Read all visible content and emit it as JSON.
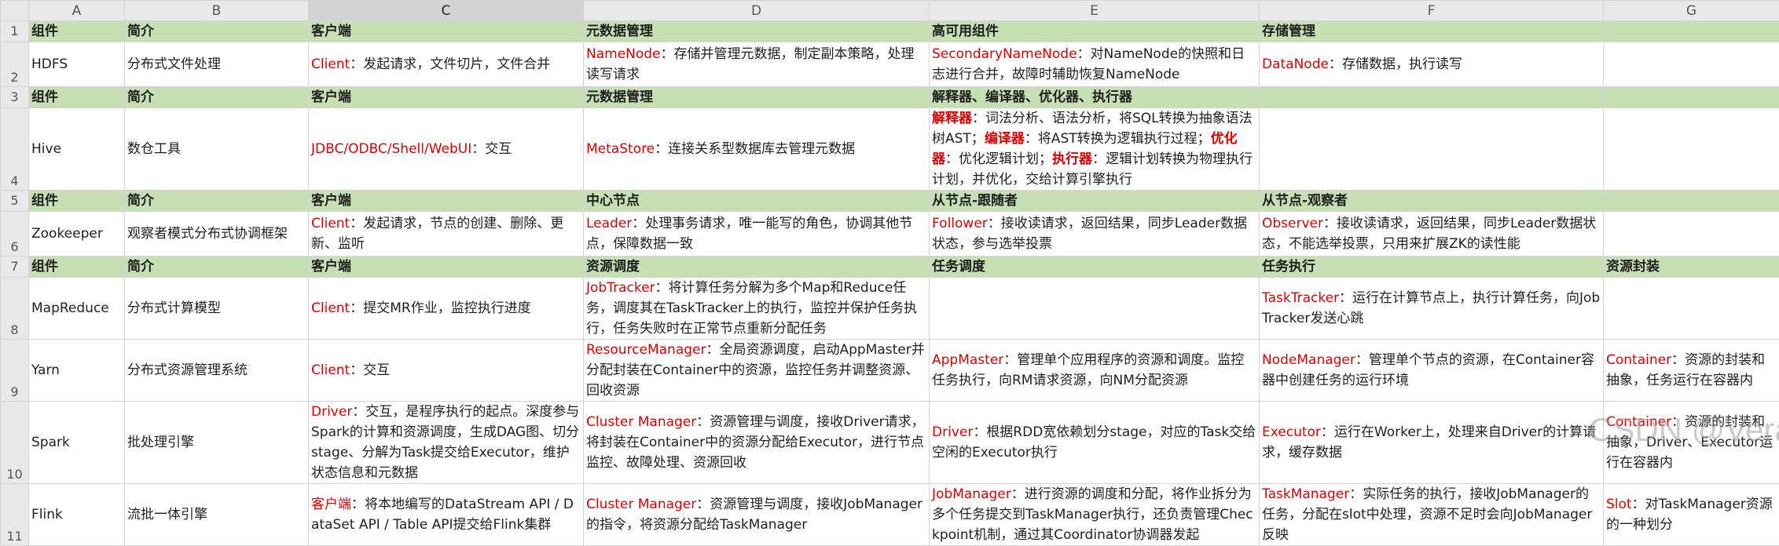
{
  "columns": [
    "A",
    "B",
    "C",
    "D",
    "E",
    "F",
    "G"
  ],
  "selected_column": "C",
  "rows": [
    {
      "num": "1",
      "header": true,
      "cells": [
        [
          {
            "t": "组件"
          }
        ],
        [
          {
            "t": "简介"
          }
        ],
        [
          {
            "t": "客户端"
          }
        ],
        [
          {
            "t": "元数据管理"
          }
        ],
        [
          {
            "t": "高可用组件"
          }
        ],
        [
          {
            "t": "存储管理"
          }
        ],
        []
      ]
    },
    {
      "num": "2",
      "header": false,
      "cells": [
        [
          {
            "t": "HDFS"
          }
        ],
        [
          {
            "t": "分布式文件处理"
          }
        ],
        [
          {
            "t": "Client",
            "k": 1
          },
          {
            "t": "：发起请求，文件切片，文件合并"
          }
        ],
        [
          {
            "t": "NameNode",
            "k": 1
          },
          {
            "t": "：存储并管理元数据，制定副本策略，处理读写请求"
          }
        ],
        [
          {
            "t": "SecondaryNameNode",
            "k": 1
          },
          {
            "t": "：对NameNode的快照和日志进行合并，故障时辅助恢复NameNode"
          }
        ],
        [
          {
            "t": "DataNode",
            "k": 1
          },
          {
            "t": "：存储数据，执行读写"
          }
        ],
        []
      ]
    },
    {
      "num": "3",
      "header": true,
      "cells": [
        [
          {
            "t": "组件"
          }
        ],
        [
          {
            "t": "简介"
          }
        ],
        [
          {
            "t": "客户端"
          }
        ],
        [
          {
            "t": "元数据管理"
          }
        ],
        [
          {
            "t": "解释器、编译器、优化器、执行器"
          }
        ],
        [],
        []
      ]
    },
    {
      "num": "4",
      "header": false,
      "cells": [
        [
          {
            "t": "Hive"
          }
        ],
        [
          {
            "t": "数仓工具"
          }
        ],
        [
          {
            "t": "JDBC/ODBC/Shell/WebUI",
            "k": 1
          },
          {
            "t": "：交互"
          }
        ],
        [
          {
            "t": "MetaStore",
            "k": 1
          },
          {
            "t": "：连接关系型数据库去管理元数据"
          }
        ],
        [
          {
            "t": "解释器",
            "k": 2
          },
          {
            "t": "：词法分析、语法分析，将SQL转换为抽象语法树AST；"
          },
          {
            "t": "编译器",
            "k": 2
          },
          {
            "t": "：将AST转换为逻辑执行过程；"
          },
          {
            "t": "优化器",
            "k": 2
          },
          {
            "t": "：优化逻辑计划；"
          },
          {
            "t": "执行器",
            "k": 2
          },
          {
            "t": "：逻辑计划转换为物理执行计划，并优化，交给计算引擎执行"
          }
        ],
        [],
        []
      ]
    },
    {
      "num": "5",
      "header": true,
      "cells": [
        [
          {
            "t": "组件"
          }
        ],
        [
          {
            "t": "简介"
          }
        ],
        [
          {
            "t": "客户端"
          }
        ],
        [
          {
            "t": "中心节点"
          }
        ],
        [
          {
            "t": "从节点-跟随者"
          }
        ],
        [
          {
            "t": "从节点-观察者"
          }
        ],
        []
      ]
    },
    {
      "num": "6",
      "header": false,
      "cells": [
        [
          {
            "t": "Zookeeper"
          }
        ],
        [
          {
            "t": "观察者模式分布式协调框架"
          }
        ],
        [
          {
            "t": "Client",
            "k": 1
          },
          {
            "t": "：发起请求，节点的创建、删除、更新、监听"
          }
        ],
        [
          {
            "t": "Leader",
            "k": 1
          },
          {
            "t": "：处理事务请求，唯一能写的角色，协调其他节点，保障数据一致"
          }
        ],
        [
          {
            "t": "Follower",
            "k": 1
          },
          {
            "t": "：接收读请求，返回结果，同步Leader数据状态，参与选举投票"
          }
        ],
        [
          {
            "t": "Observer",
            "k": 1
          },
          {
            "t": "：接收读请求，返回结果，同步Leader数据状态，不能选举投票，只用来扩展ZK的读性能"
          }
        ],
        []
      ]
    },
    {
      "num": "7",
      "header": true,
      "cells": [
        [
          {
            "t": "组件"
          }
        ],
        [
          {
            "t": "简介"
          }
        ],
        [
          {
            "t": "客户端"
          }
        ],
        [
          {
            "t": "资源调度"
          }
        ],
        [
          {
            "t": "任务调度"
          }
        ],
        [
          {
            "t": "任务执行"
          }
        ],
        [
          {
            "t": "资源封装"
          }
        ]
      ]
    },
    {
      "num": "8",
      "header": false,
      "cells": [
        [
          {
            "t": "MapReduce"
          }
        ],
        [
          {
            "t": "分布式计算模型"
          }
        ],
        [
          {
            "t": "Client",
            "k": 1
          },
          {
            "t": "：提交MR作业，监控执行进度"
          }
        ],
        [
          {
            "t": "JobTracker",
            "k": 1
          },
          {
            "t": "：将计算任务分解为多个Map和Reduce任务，调度其在TaskTracker上的执行，监控并保护任务执行，任务失败时在正常节点重新分配任务"
          }
        ],
        [],
        [
          {
            "t": "TaskTracker",
            "k": 1
          },
          {
            "t": "：运行在计算节点上，执行计算任务，向JobTracker发送心跳"
          }
        ],
        []
      ]
    },
    {
      "num": "9",
      "header": false,
      "cells": [
        [
          {
            "t": "Yarn"
          }
        ],
        [
          {
            "t": "分布式资源管理系统"
          }
        ],
        [
          {
            "t": "Client",
            "k": 1
          },
          {
            "t": "：交互"
          }
        ],
        [
          {
            "t": "ResourceManager",
            "k": 1
          },
          {
            "t": "：全局资源调度，启动AppMaster并分配封装在Container中的资源，监控任务并调整资源、回收资源"
          }
        ],
        [
          {
            "t": "AppMaster",
            "k": 1
          },
          {
            "t": "：管理单个应用程序的资源和调度。监控任务执行，向RM请求资源，向NM分配资源"
          }
        ],
        [
          {
            "t": "NodeManager",
            "k": 1
          },
          {
            "t": "：管理单个节点的资源，在Container容器中创建任务的运行环境"
          }
        ],
        [
          {
            "t": "Container",
            "k": 1
          },
          {
            "t": "：资源的封装和抽象，任务运行在容器内"
          }
        ]
      ]
    },
    {
      "num": "10",
      "header": false,
      "cells": [
        [
          {
            "t": "Spark"
          }
        ],
        [
          {
            "t": "批处理引擎"
          }
        ],
        [
          {
            "t": "Driver",
            "k": 1
          },
          {
            "t": "：交互，是程序执行的起点。深度参与Spark的计算和资源调度，生成DAG图、切分stage、分解为Task提交给Executor，维护状态信息和元数据"
          }
        ],
        [
          {
            "t": "Cluster Manager",
            "k": 1
          },
          {
            "t": "：资源管理与调度，接收Driver请求，将封装在Container中的资源分配给Executor，进行节点监控、故障处理、资源回收"
          }
        ],
        [
          {
            "t": "Driver",
            "k": 1
          },
          {
            "t": "：根据RDD宽依赖划分stage，对应的Task交给空闲的Executor执行"
          }
        ],
        [
          {
            "t": "Executor",
            "k": 1
          },
          {
            "t": "：运行在Worker上，处理来自Driver的计算请求，缓存数据"
          }
        ],
        [
          {
            "t": "Container",
            "k": 1
          },
          {
            "t": "：资源的封装和抽象，Driver、Executor运行在容器内"
          }
        ]
      ]
    },
    {
      "num": "11",
      "header": false,
      "cells": [
        [
          {
            "t": "Flink"
          }
        ],
        [
          {
            "t": "流批一体引擎"
          }
        ],
        [
          {
            "t": "客户端",
            "k": 1
          },
          {
            "t": "：将本地编写的DataStream API / DataSet API / Table API提交给Flink集群"
          }
        ],
        [
          {
            "t": "Cluster Manager",
            "k": 1
          },
          {
            "t": "：资源管理与调度，接收JobManager的指令，将资源分配给TaskManager"
          }
        ],
        [
          {
            "t": "JobManager",
            "k": 1
          },
          {
            "t": "：进行资源的调度和分配，将作业拆分为多个任务提交到TaskManager执行，还负责管理Checkpoint机制，通过其Coordinator协调器发起"
          }
        ],
        [
          {
            "t": "TaskManager",
            "k": 1
          },
          {
            "t": "：实际任务的执行，接收JobManager的任务，分配在slot中处理，资源不足时会向JobManager反映"
          }
        ],
        [
          {
            "t": "Slot",
            "k": 1
          },
          {
            "t": "：对TaskManager资源的一种划分"
          }
        ]
      ]
    }
  ],
  "watermark": "CSDN @Veraura",
  "colors": {
    "header_bg": "#c6e0b4",
    "keyword": "#e00000",
    "grid": "#d4d4d4",
    "headings_bg": "#e9e9e9"
  }
}
